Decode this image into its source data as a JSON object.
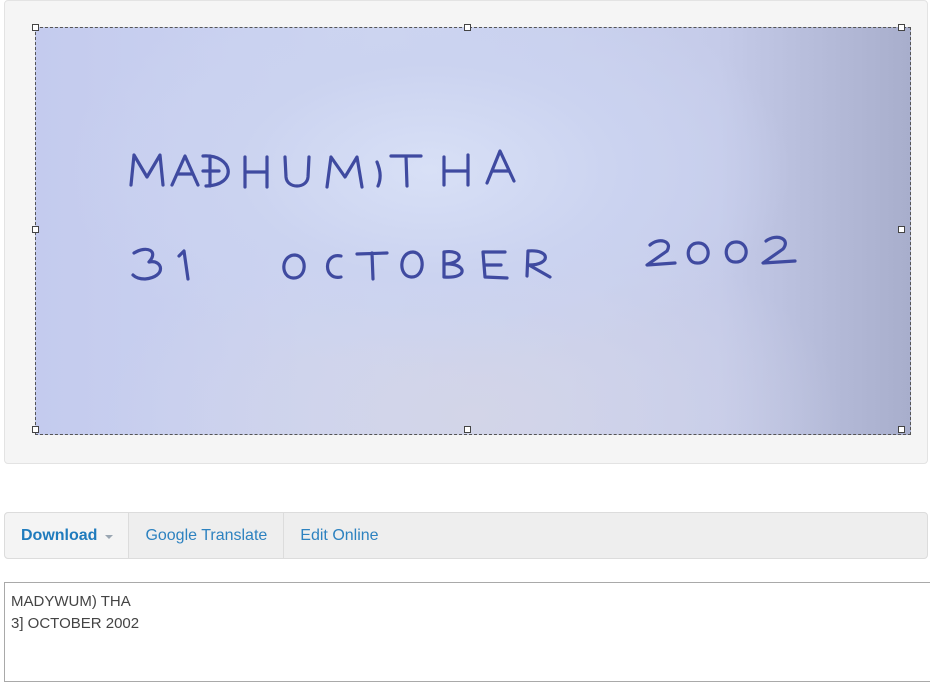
{
  "image": {
    "handwritten_text": [
      "MADHUMITHA",
      "31 OCTOBER 2002"
    ]
  },
  "toolbar": {
    "download_label": "Download",
    "translate_label": "Google Translate",
    "edit_label": "Edit Online"
  },
  "result": {
    "lines": [
      "MADYWUM) THA",
      "3] OCTOBER 2002"
    ]
  },
  "colors": {
    "link": "#2d82c0",
    "ink": "#3f4aa0",
    "panel_bg": "#f5f5f5",
    "toolbar_bg": "#eeeeee"
  },
  "icons": {
    "dropdown": "caret-down-icon"
  }
}
